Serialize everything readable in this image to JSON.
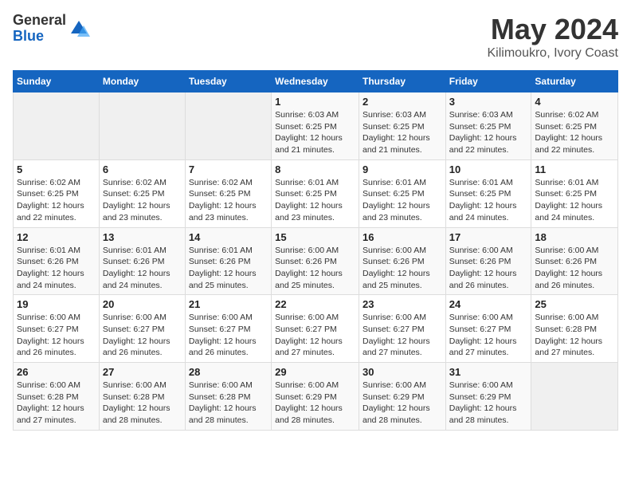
{
  "logo": {
    "general": "General",
    "blue": "Blue"
  },
  "title": {
    "month_year": "May 2024",
    "location": "Kilimoukro, Ivory Coast"
  },
  "days_of_week": [
    "Sunday",
    "Monday",
    "Tuesday",
    "Wednesday",
    "Thursday",
    "Friday",
    "Saturday"
  ],
  "weeks": [
    [
      {
        "day": "",
        "detail": ""
      },
      {
        "day": "",
        "detail": ""
      },
      {
        "day": "",
        "detail": ""
      },
      {
        "day": "1",
        "detail": "Sunrise: 6:03 AM\nSunset: 6:25 PM\nDaylight: 12 hours and 21 minutes."
      },
      {
        "day": "2",
        "detail": "Sunrise: 6:03 AM\nSunset: 6:25 PM\nDaylight: 12 hours and 21 minutes."
      },
      {
        "day": "3",
        "detail": "Sunrise: 6:03 AM\nSunset: 6:25 PM\nDaylight: 12 hours and 22 minutes."
      },
      {
        "day": "4",
        "detail": "Sunrise: 6:02 AM\nSunset: 6:25 PM\nDaylight: 12 hours and 22 minutes."
      }
    ],
    [
      {
        "day": "5",
        "detail": "Sunrise: 6:02 AM\nSunset: 6:25 PM\nDaylight: 12 hours and 22 minutes."
      },
      {
        "day": "6",
        "detail": "Sunrise: 6:02 AM\nSunset: 6:25 PM\nDaylight: 12 hours and 23 minutes."
      },
      {
        "day": "7",
        "detail": "Sunrise: 6:02 AM\nSunset: 6:25 PM\nDaylight: 12 hours and 23 minutes."
      },
      {
        "day": "8",
        "detail": "Sunrise: 6:01 AM\nSunset: 6:25 PM\nDaylight: 12 hours and 23 minutes."
      },
      {
        "day": "9",
        "detail": "Sunrise: 6:01 AM\nSunset: 6:25 PM\nDaylight: 12 hours and 23 minutes."
      },
      {
        "day": "10",
        "detail": "Sunrise: 6:01 AM\nSunset: 6:25 PM\nDaylight: 12 hours and 24 minutes."
      },
      {
        "day": "11",
        "detail": "Sunrise: 6:01 AM\nSunset: 6:25 PM\nDaylight: 12 hours and 24 minutes."
      }
    ],
    [
      {
        "day": "12",
        "detail": "Sunrise: 6:01 AM\nSunset: 6:26 PM\nDaylight: 12 hours and 24 minutes."
      },
      {
        "day": "13",
        "detail": "Sunrise: 6:01 AM\nSunset: 6:26 PM\nDaylight: 12 hours and 24 minutes."
      },
      {
        "day": "14",
        "detail": "Sunrise: 6:01 AM\nSunset: 6:26 PM\nDaylight: 12 hours and 25 minutes."
      },
      {
        "day": "15",
        "detail": "Sunrise: 6:00 AM\nSunset: 6:26 PM\nDaylight: 12 hours and 25 minutes."
      },
      {
        "day": "16",
        "detail": "Sunrise: 6:00 AM\nSunset: 6:26 PM\nDaylight: 12 hours and 25 minutes."
      },
      {
        "day": "17",
        "detail": "Sunrise: 6:00 AM\nSunset: 6:26 PM\nDaylight: 12 hours and 26 minutes."
      },
      {
        "day": "18",
        "detail": "Sunrise: 6:00 AM\nSunset: 6:26 PM\nDaylight: 12 hours and 26 minutes."
      }
    ],
    [
      {
        "day": "19",
        "detail": "Sunrise: 6:00 AM\nSunset: 6:27 PM\nDaylight: 12 hours and 26 minutes."
      },
      {
        "day": "20",
        "detail": "Sunrise: 6:00 AM\nSunset: 6:27 PM\nDaylight: 12 hours and 26 minutes."
      },
      {
        "day": "21",
        "detail": "Sunrise: 6:00 AM\nSunset: 6:27 PM\nDaylight: 12 hours and 26 minutes."
      },
      {
        "day": "22",
        "detail": "Sunrise: 6:00 AM\nSunset: 6:27 PM\nDaylight: 12 hours and 27 minutes."
      },
      {
        "day": "23",
        "detail": "Sunrise: 6:00 AM\nSunset: 6:27 PM\nDaylight: 12 hours and 27 minutes."
      },
      {
        "day": "24",
        "detail": "Sunrise: 6:00 AM\nSunset: 6:27 PM\nDaylight: 12 hours and 27 minutes."
      },
      {
        "day": "25",
        "detail": "Sunrise: 6:00 AM\nSunset: 6:28 PM\nDaylight: 12 hours and 27 minutes."
      }
    ],
    [
      {
        "day": "26",
        "detail": "Sunrise: 6:00 AM\nSunset: 6:28 PM\nDaylight: 12 hours and 27 minutes."
      },
      {
        "day": "27",
        "detail": "Sunrise: 6:00 AM\nSunset: 6:28 PM\nDaylight: 12 hours and 28 minutes."
      },
      {
        "day": "28",
        "detail": "Sunrise: 6:00 AM\nSunset: 6:28 PM\nDaylight: 12 hours and 28 minutes."
      },
      {
        "day": "29",
        "detail": "Sunrise: 6:00 AM\nSunset: 6:29 PM\nDaylight: 12 hours and 28 minutes."
      },
      {
        "day": "30",
        "detail": "Sunrise: 6:00 AM\nSunset: 6:29 PM\nDaylight: 12 hours and 28 minutes."
      },
      {
        "day": "31",
        "detail": "Sunrise: 6:00 AM\nSunset: 6:29 PM\nDaylight: 12 hours and 28 minutes."
      },
      {
        "day": "",
        "detail": ""
      }
    ]
  ]
}
